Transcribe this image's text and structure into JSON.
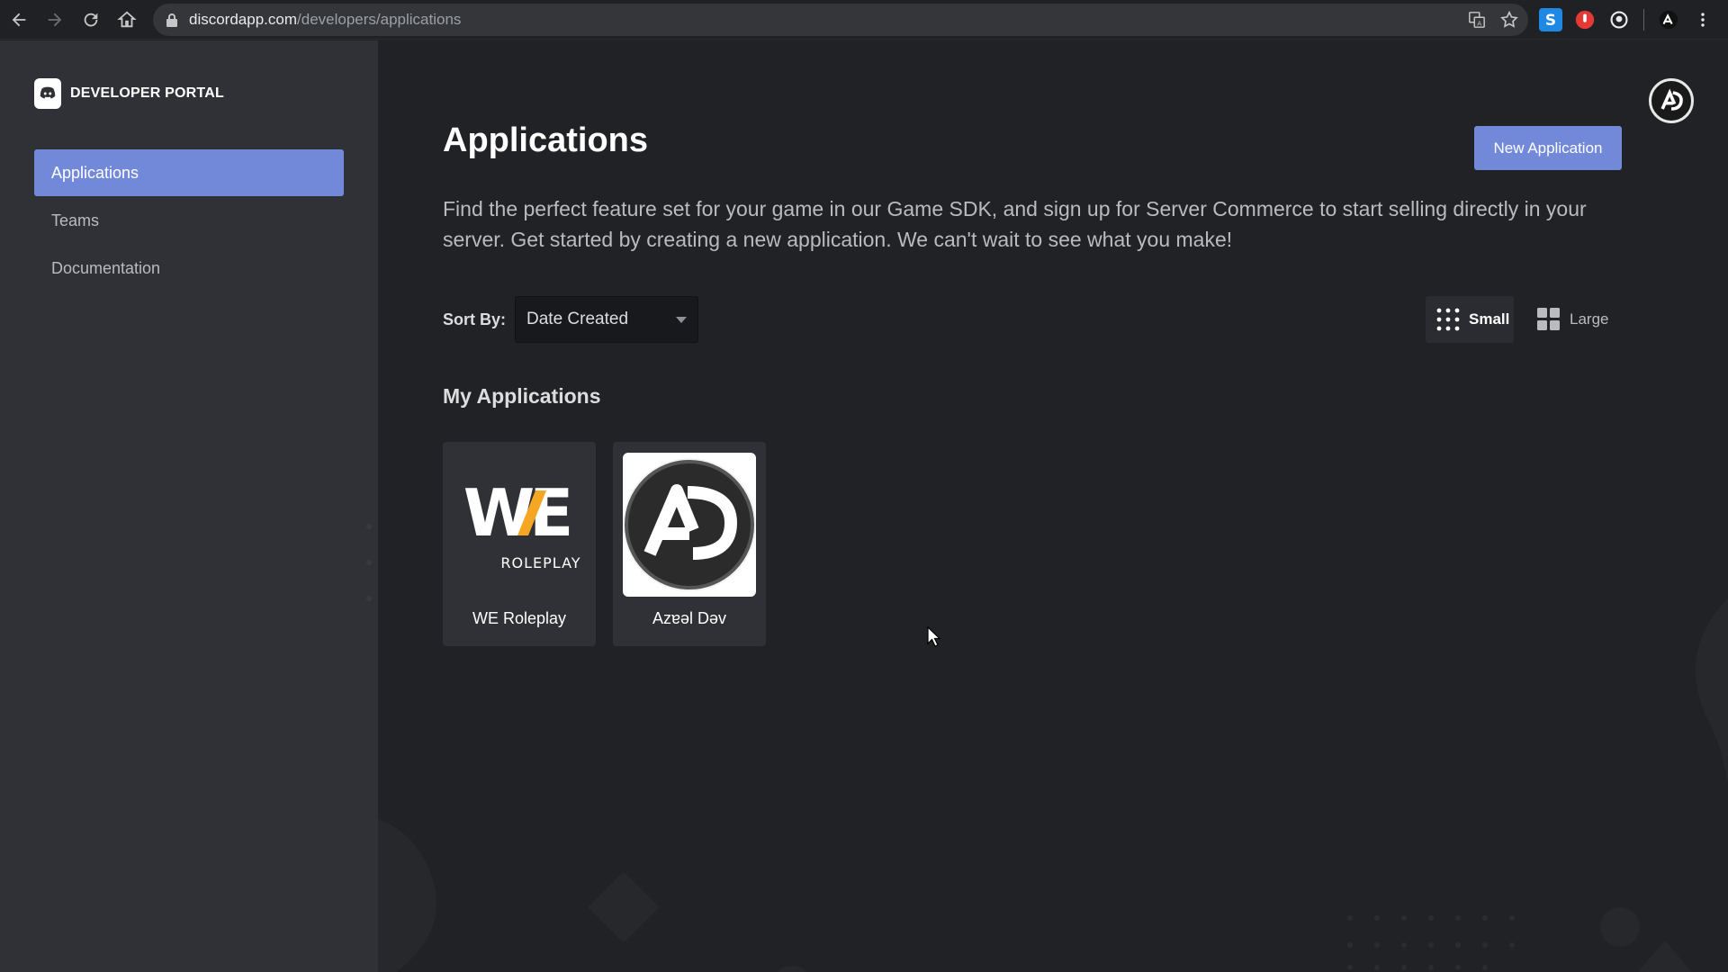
{
  "browser": {
    "url_host": "discordapp.com",
    "url_path": "/developers/applications",
    "icons": [
      "back-icon",
      "forward-icon",
      "reload-icon",
      "home-icon",
      "lock-icon",
      "translate-icon",
      "star-icon"
    ],
    "extensions": [
      "s-extension-icon",
      "red-extension-icon",
      "github-icon",
      "profile-icon",
      "menu-icon"
    ]
  },
  "sidebar": {
    "brand": "DEVELOPER PORTAL",
    "items": [
      {
        "label": "Applications",
        "active": true
      },
      {
        "label": "Teams",
        "active": false
      },
      {
        "label": "Documentation",
        "active": false
      }
    ]
  },
  "main": {
    "title": "Applications",
    "new_button": "New Application",
    "intro": "Find the perfect feature set for your game in our Game SDK, and sign up for Server Commerce to start selling directly in your server. Get started by creating a new application. We can't wait to see what you make!",
    "sort_label": "Sort By:",
    "sort_value": "Date Created",
    "view_small": "Small",
    "view_large": "Large",
    "section_title": "My Applications",
    "apps": [
      {
        "name": "WE Roleplay",
        "logo_text_main": "WE",
        "logo_text_sub": "ROLEPLAY"
      },
      {
        "name": "Azɐǝl Dǝv",
        "logo_text_main": "AD"
      }
    ]
  },
  "colors": {
    "blurple": "#7289da",
    "sidebar_bg": "#2f3136",
    "main_bg": "#202225",
    "we_orange": "#f5a623"
  }
}
